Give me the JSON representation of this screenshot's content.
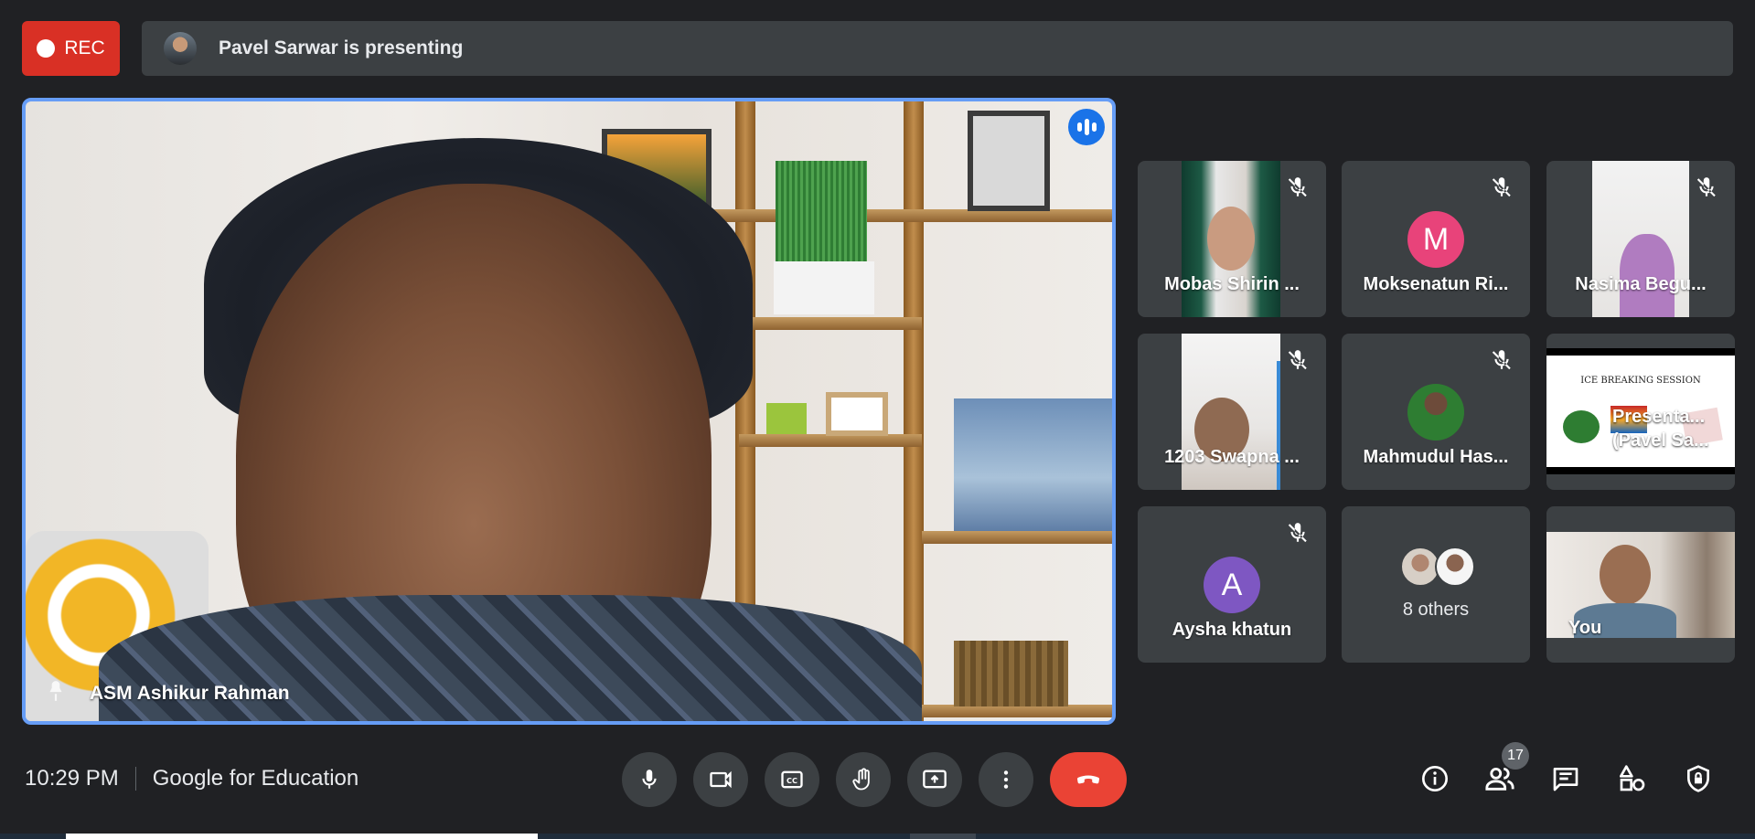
{
  "top_bar": {
    "rec_label": "REC",
    "presenting_text": "Pavel Sarwar is presenting"
  },
  "main_speaker": {
    "name": "ASM Ashikur Rahman"
  },
  "participants": [
    {
      "name": "Mobas Shirin ...",
      "type": "video",
      "muted": true
    },
    {
      "name": "Moksenatun Ri...",
      "type": "letter",
      "letter": "M",
      "color": "#e8437a",
      "muted": true
    },
    {
      "name": "Nasima Begu...",
      "type": "video",
      "muted": true
    },
    {
      "name": "1203 Swapna ...",
      "type": "video",
      "muted": true
    },
    {
      "name": "Mahmudul Has...",
      "type": "photo",
      "muted": true
    },
    {
      "name_line1": "Presenta...",
      "name_line2": "(Pavel Sa...",
      "slide_title": "ICE BREAKING SESSION",
      "type": "presentation"
    },
    {
      "name": "Aysha khatun",
      "type": "letter",
      "letter": "A",
      "color": "#7e57c2",
      "muted": true
    },
    {
      "name": "8 others",
      "type": "others"
    },
    {
      "name": "You",
      "type": "video"
    }
  ],
  "bottom_bar": {
    "time": "10:29 PM",
    "meeting_label": "Google for Education",
    "participant_count": "17"
  },
  "colors": {
    "background": "#202124",
    "tile": "#3c4043",
    "rec": "#d93025",
    "end_call": "#ea4335",
    "active_border": "#669df6",
    "speaking": "#1a73e8"
  },
  "icons": [
    "mic-icon",
    "camera-icon",
    "captions-icon",
    "raise-hand-icon",
    "present-icon",
    "more-vert-icon",
    "end-call-icon",
    "info-icon",
    "people-icon",
    "chat-icon",
    "activities-icon",
    "host-controls-icon",
    "mic-off-icon"
  ]
}
